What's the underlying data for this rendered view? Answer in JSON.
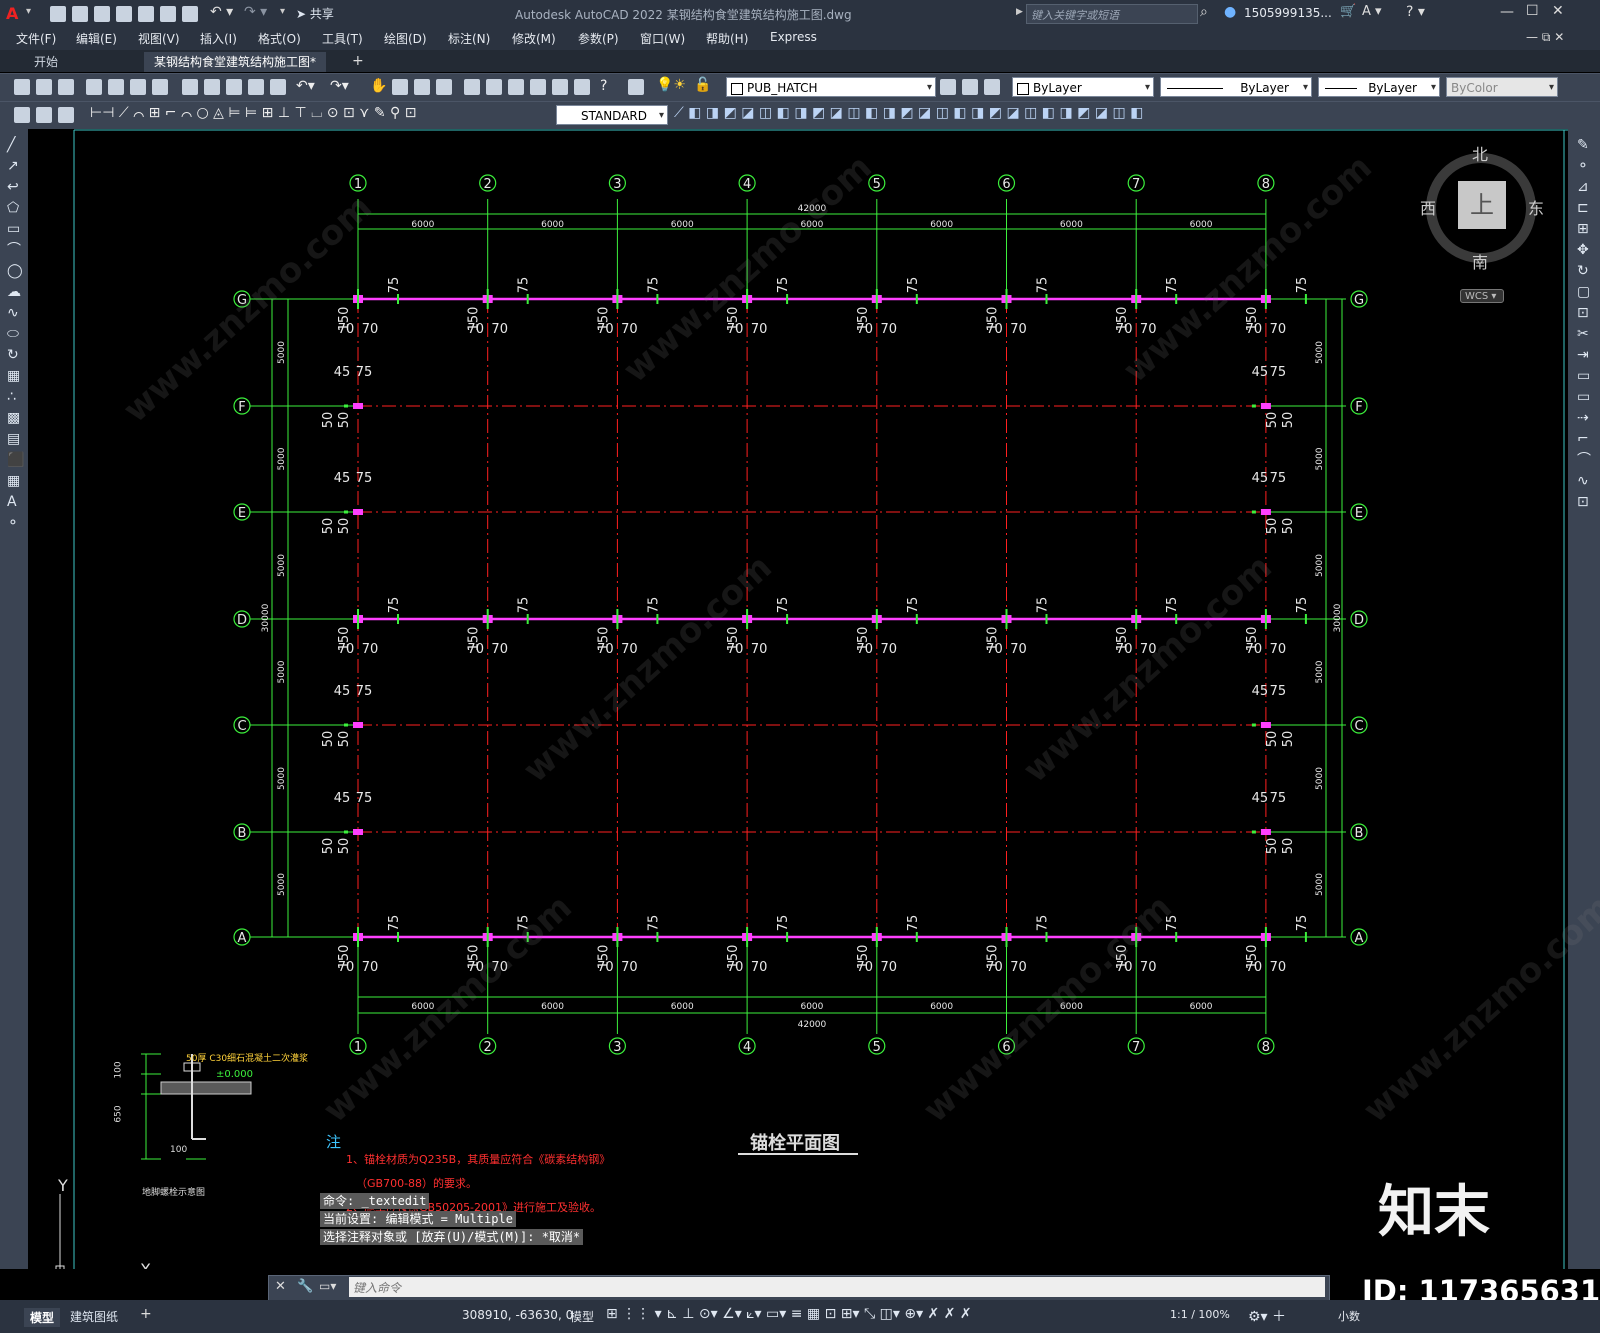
{
  "window": {
    "title": "Autodesk AutoCAD 2022    某钢结构食堂建筑结构施工图.dwg",
    "share_label": "共享",
    "search_placeholder": "键入关键字或短语",
    "user": "1505999135...",
    "controls": [
      "—",
      "□",
      "✕"
    ]
  },
  "menu": [
    "文件(F)",
    "编辑(E)",
    "视图(V)",
    "插入(I)",
    "格式(O)",
    "工具(T)",
    "绘图(D)",
    "标注(N)",
    "修改(M)",
    "参数(P)",
    "窗口(W)",
    "帮助(H)",
    "Express"
  ],
  "doc_tabs": [
    "开始",
    "某钢结构食堂建筑结构施工图*"
  ],
  "toolbar": {
    "layer": "PUB_HATCH",
    "color": "ByLayer",
    "linetype": "ByLayer",
    "lineweight": "ByLayer",
    "plotstyle": "ByColor",
    "textstyle": "STANDARD"
  },
  "viewcube": {
    "north": "北",
    "south": "南",
    "east": "东",
    "west": "西",
    "face": "上",
    "wcs": "WCS"
  },
  "drawing": {
    "title": "锚栓平面图",
    "col_labels": [
      "1",
      "2",
      "3",
      "4",
      "5",
      "6",
      "7",
      "8"
    ],
    "row_labels": [
      "G",
      "F",
      "E",
      "D",
      "C",
      "B",
      "A"
    ],
    "bay_dim": "6000",
    "total_x": "42000",
    "span_dim": "5000",
    "total_y": "30000",
    "dims_top": [
      "70",
      "70",
      "150",
      "75"
    ],
    "dims_side": [
      "45",
      "75",
      "50",
      "50"
    ],
    "detail_label": "地脚螺栓示意图",
    "detail_notes": [
      "50厚 C30细石混凝土二次灌浆",
      "±0.000",
      "100",
      "650",
      "100"
    ],
    "note_title": "注",
    "note_lines": [
      "1、锚栓材质为Q235B，其质量应符合《碳素结构钢》",
      "（GB700-88）的要求。",
      "2、施工应按照GB50205-2001》进行施工及验收。"
    ]
  },
  "command": {
    "history": [
      "命令:  _textedit",
      "当前设置: 编辑模式 = Multiple",
      "选择注释对象或 [放弃(U)/模式(M)]: *取消*"
    ],
    "placeholder": "键入命令"
  },
  "status": {
    "coords": "308910, -63630, 0",
    "mode": "模型",
    "scale": "1:1 / 100%",
    "units": "小数",
    "tabs": [
      "模型",
      "建筑图纸"
    ]
  },
  "watermark": {
    "brand": "知末",
    "id": "ID: 1173656317",
    "url": "www.znzmo.com"
  }
}
